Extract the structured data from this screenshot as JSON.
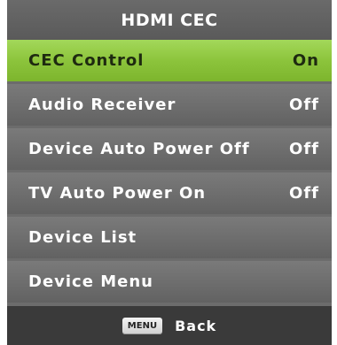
{
  "window": {
    "title": "HDMI CEC"
  },
  "menu": {
    "items": [
      {
        "label": "CEC Control",
        "value": "On",
        "selected": true
      },
      {
        "label": "Audio Receiver",
        "value": "Off",
        "selected": false
      },
      {
        "label": "Device Auto Power Off",
        "value": "Off",
        "selected": false
      },
      {
        "label": "TV Auto Power On",
        "value": "Off",
        "selected": false
      },
      {
        "label": "Device List",
        "value": "",
        "selected": false
      },
      {
        "label": "Device Menu",
        "value": "",
        "selected": false
      }
    ]
  },
  "footer": {
    "key_label": "MENU",
    "action_label": "Back"
  },
  "colors": {
    "selected_row": "#8cc43c",
    "row": "#6d6d6d",
    "footer": "#3a3a3a"
  }
}
